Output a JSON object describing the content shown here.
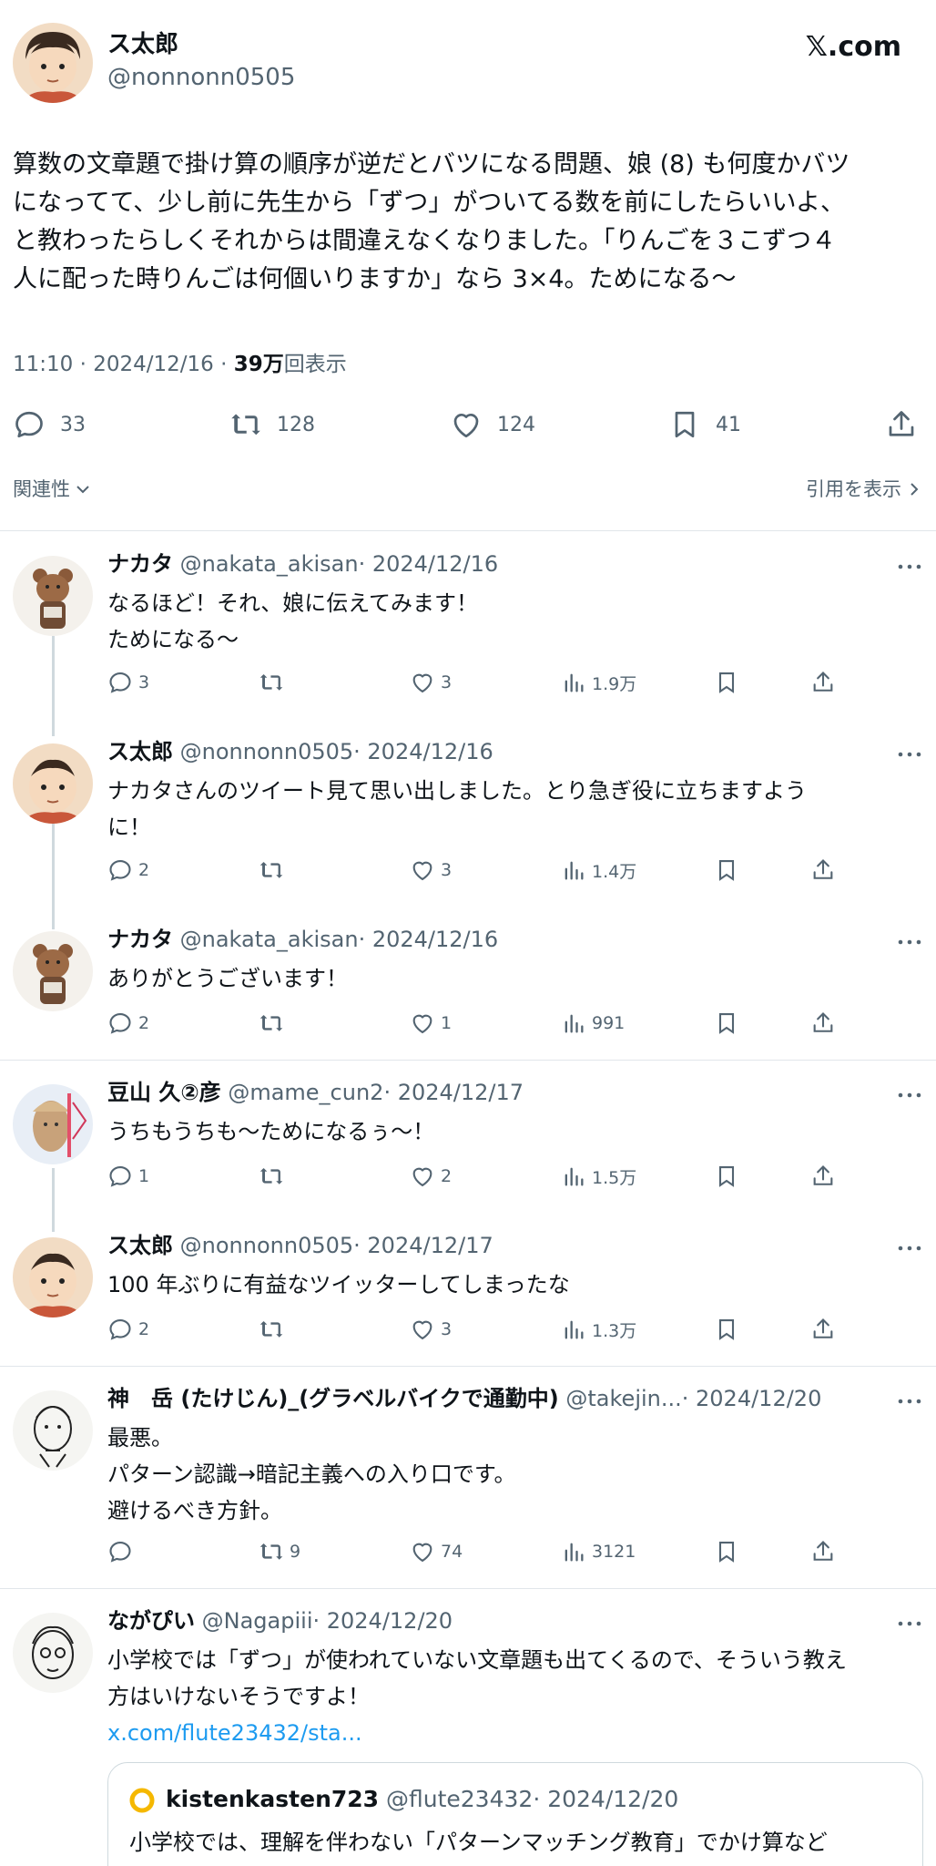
{
  "main": {
    "name": "ス太郎",
    "handle": "@nonnonn0505",
    "brand": "𝕏.com",
    "text_lines": [
      "算数の文章題で掛け算の順序が逆だとバツになる問題、娘 (8) も何度かバツ",
      "になってて、少し前に先生から「ずつ」がついてる数を前にしたらいいよ、",
      "と教わったらしくそれからは間違えなくなりました。「りんごを３こずつ４",
      "人に配った時りんごは何個いりますか」なら 3×4。ためになる〜"
    ],
    "time": "11:10 · 2024/12/16 · ",
    "views_count": "39万",
    "views_label": "回表示",
    "actions": {
      "replies": "33",
      "retweets": "128",
      "likes": "124",
      "bookmarks": "41"
    },
    "related_label": "関連性",
    "quotes_label": "引用を表示"
  },
  "replies": [
    {
      "name": "ナカタ",
      "handle": "@nakata_akisan",
      "date": "· 2024/12/16",
      "text_lines": [
        "なるほど！それ、娘に伝えてみます！",
        "ためになる〜"
      ],
      "replies": "3",
      "retweets": "",
      "likes": "3",
      "views": "1.9万"
    },
    {
      "name": "ス太郎",
      "handle": "@nonnonn0505",
      "date": "· 2024/12/16",
      "text_lines": [
        "ナカタさんのツイート見て思い出しました。とり急ぎ役に立ちますよう",
        "に！"
      ],
      "replies": "2",
      "retweets": "",
      "likes": "3",
      "views": "1.4万"
    },
    {
      "name": "ナカタ",
      "handle": "@nakata_akisan",
      "date": "· 2024/12/16",
      "text_lines": [
        "ありがとうございます！"
      ],
      "replies": "2",
      "retweets": "",
      "likes": "1",
      "views": "991"
    },
    {
      "name": "豆山 久②彦",
      "handle": "@mame_cun2",
      "date": "· 2024/12/17",
      "text_lines": [
        "うちもうちも〜ためになるぅ〜！"
      ],
      "replies": "1",
      "retweets": "",
      "likes": "2",
      "views": "1.5万"
    },
    {
      "name": "ス太郎",
      "handle": "@nonnonn0505",
      "date": "· 2024/12/17",
      "text_lines": [
        "100 年ぶりに有益なツイッターしてしまったな"
      ],
      "replies": "2",
      "retweets": "",
      "likes": "3",
      "views": "1.3万"
    },
    {
      "name": "神　岳 (たけじん)_(グラベルバイクで通勤中)",
      "handle": "@takejin...",
      "date": "· 2024/12/20",
      "text_lines": [
        "最悪。",
        "パターン認識→暗記主義への入り口です。",
        "避けるべき方針。"
      ],
      "replies": "",
      "retweets": "9",
      "likes": "74",
      "views": "3121"
    },
    {
      "name": "ながぴい",
      "handle": "@Nagapiii",
      "date": "· 2024/12/20",
      "text_lines": [
        "小学校では「ずつ」が使われていない文章題も出てくるので、そういう教え",
        "方はいけないそうですよ！"
      ],
      "link": "x.com/flute23432/sta..."
    }
  ],
  "quote": {
    "name": "kistenkasten723",
    "handle": "@flute23432",
    "date": "· 2024/12/20",
    "text": "小学校では、理解を伴わない「パターンマッチング教育」でかけ算など"
  },
  "colors": {
    "text": "#0f1419",
    "secondary": "#536471",
    "link": "#1d9bf0",
    "border": "#cfd9de"
  }
}
